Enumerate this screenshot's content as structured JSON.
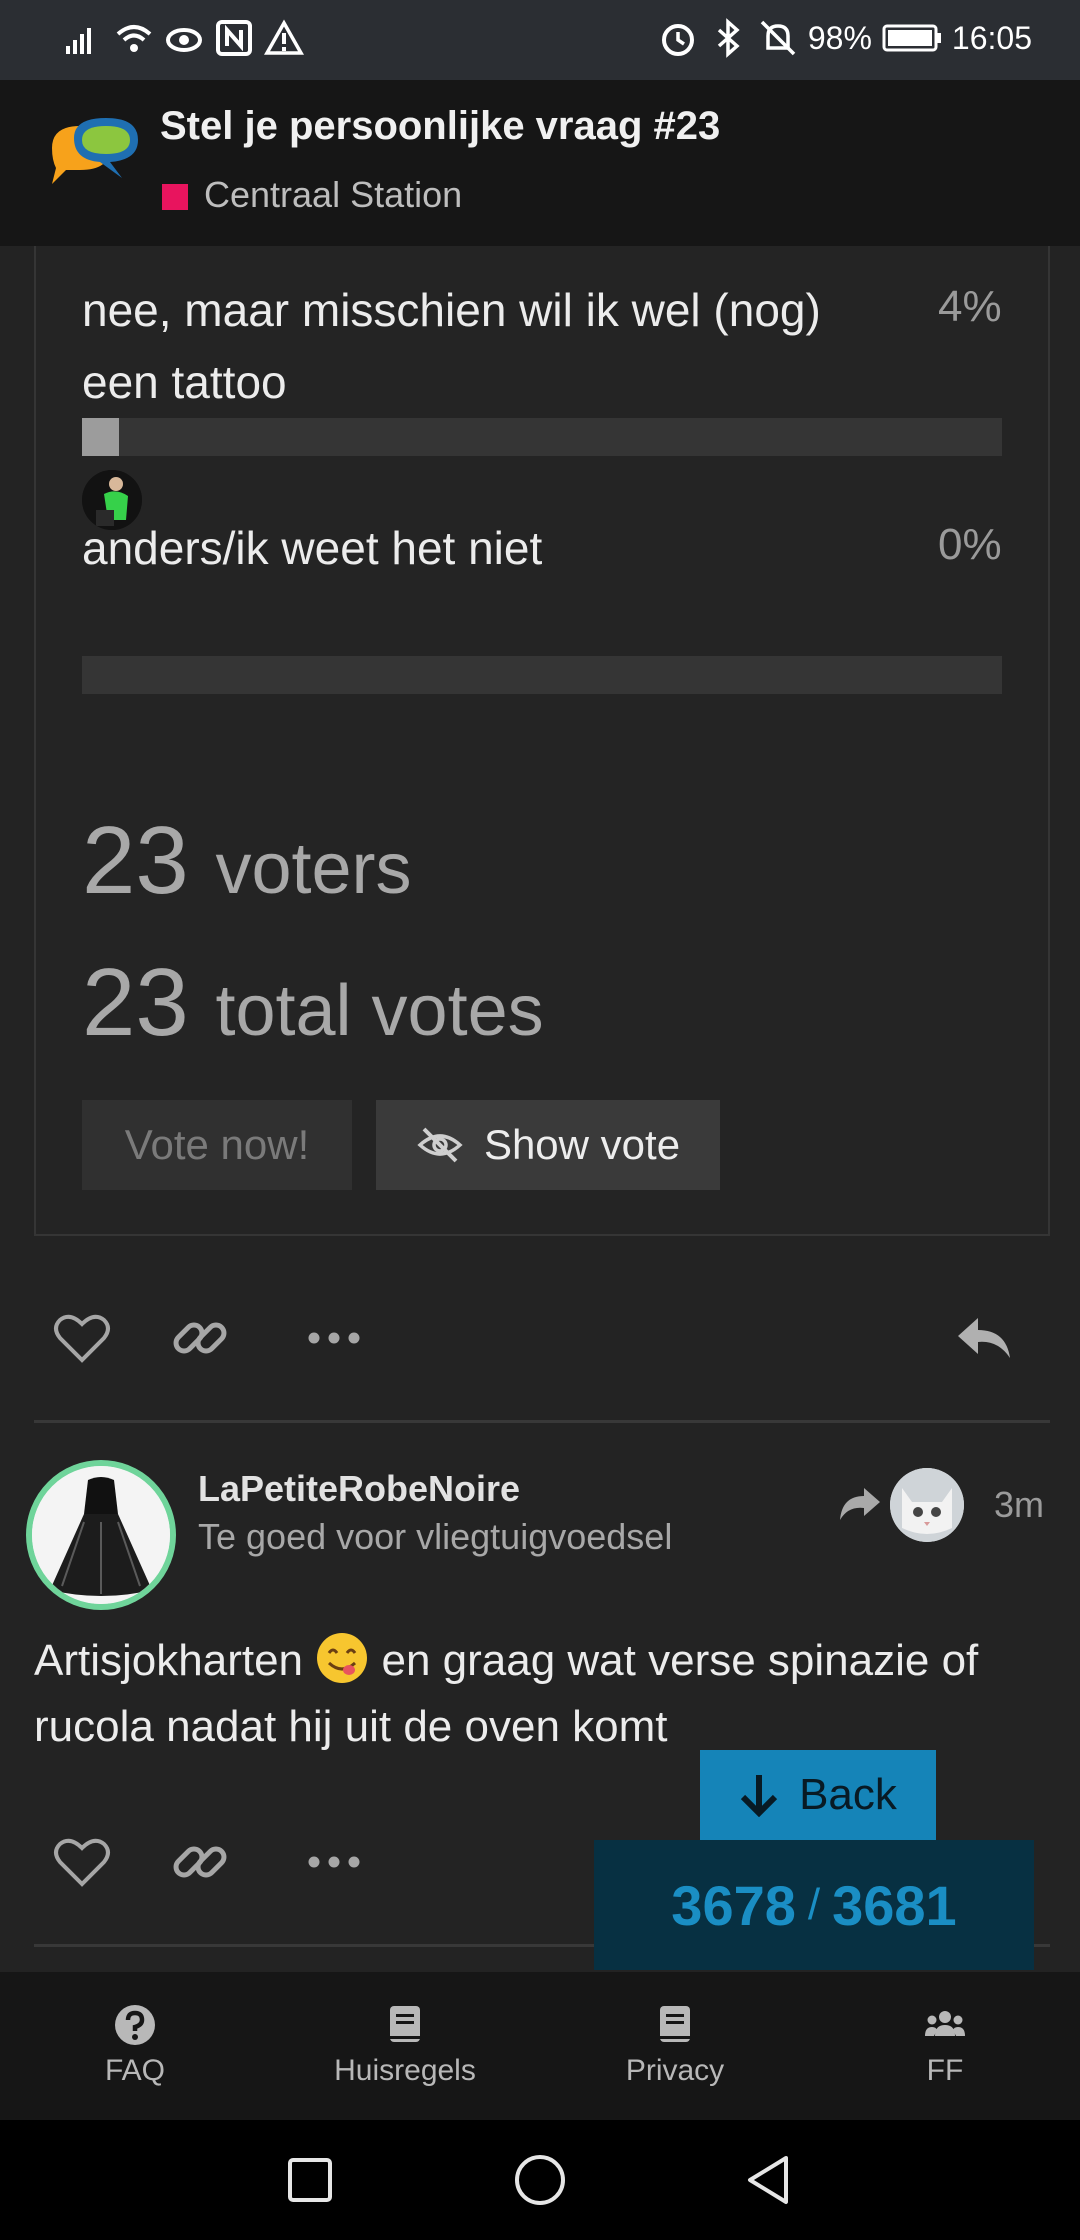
{
  "status_bar": {
    "battery": "98%",
    "time": "16:05"
  },
  "header": {
    "title": "Stel je persoonlijke vraag #23",
    "category": "Centraal Station",
    "category_color": "#e8145e"
  },
  "poll": {
    "options": [
      {
        "label_line1": "nee, maar misschien wil ik wel (nog)",
        "label_line2": "een tattoo",
        "percent": "4%",
        "fill": 0.04
      },
      {
        "label_line1": "anders/ik weet het niet",
        "label_line2": "",
        "percent": "0%",
        "fill": 0.0
      }
    ],
    "voters_count": "23",
    "voters_label": "voters",
    "votes_count": "23",
    "votes_label": "total votes",
    "vote_now_label": "Vote now!",
    "show_vote_label": "Show vote"
  },
  "post": {
    "username": "LaPetiteRobeNoire",
    "user_title": "Te goed voor vliegtuigvoedsel",
    "time": "3m",
    "body_part1": "Artisjokharten",
    "body_part2": " en graag wat verse spinazie of rucola nadat hij uit de oven komt"
  },
  "progress": {
    "back_label": "Back",
    "current": "3678",
    "separator": "/",
    "total": "3681"
  },
  "bottom_nav": [
    {
      "label": "FAQ",
      "icon": "question-circle-icon"
    },
    {
      "label": "Huisregels",
      "icon": "book-icon"
    },
    {
      "label": "Privacy",
      "icon": "book-icon"
    },
    {
      "label": "FF",
      "icon": "users-icon"
    }
  ],
  "colors": {
    "accent": "#1584b8",
    "avatar_ring": "#6fd49a"
  }
}
